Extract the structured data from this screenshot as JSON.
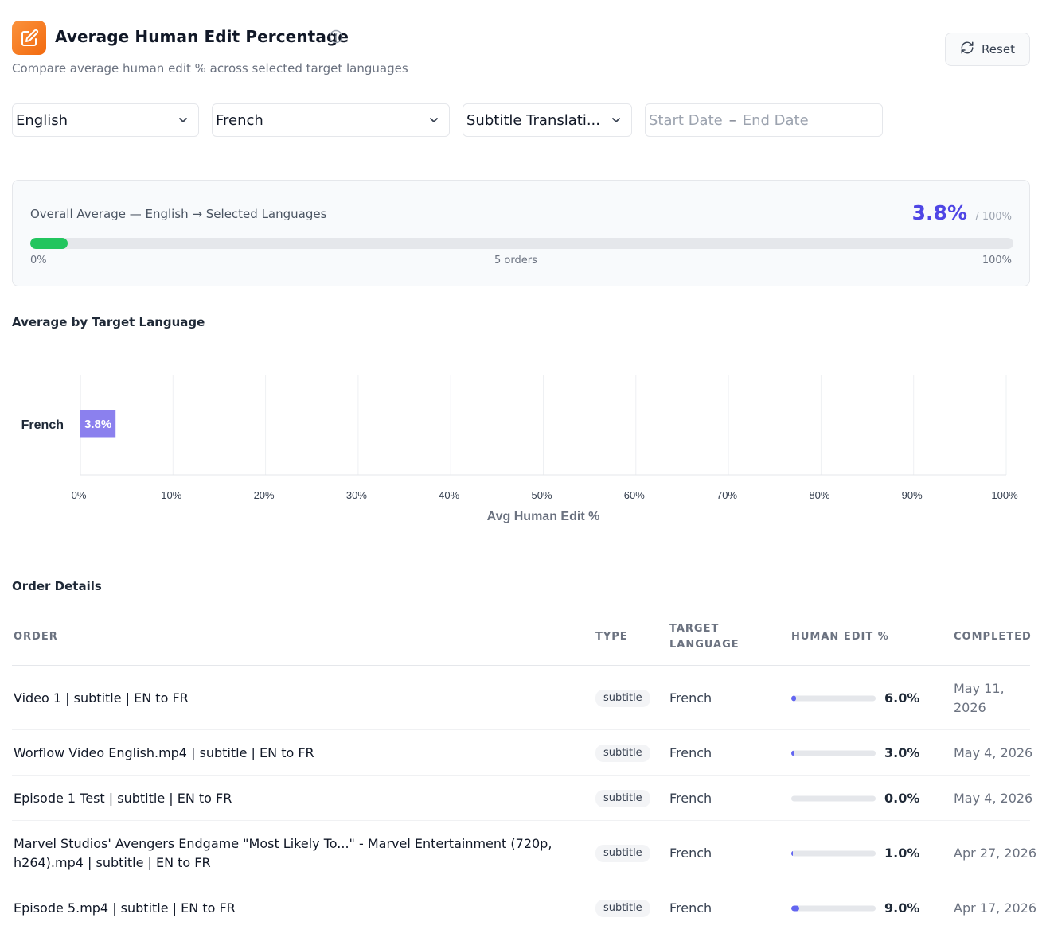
{
  "header": {
    "title": "Average Human Edit Percentage",
    "subtitle": "Compare average human edit % across selected target languages",
    "reset_label": "Reset",
    "logo_icon": "edit-icon",
    "accent": "#f97316"
  },
  "filters": {
    "source_language": "English",
    "target_language": "French",
    "type": "Subtitle Translati...",
    "date_start_placeholder": "Start Date",
    "date_separator": "–",
    "date_end_placeholder": "End Date"
  },
  "overall": {
    "label": "Overall Average — English → Selected Languages",
    "value": "3.8%",
    "value_number": 3.8,
    "max": "/ 100%",
    "scale_min": "0%",
    "orders": "5 orders",
    "scale_max": "100%",
    "fill_color": "#22c55e"
  },
  "chart_section": {
    "title": "Average by Target Language"
  },
  "chart_data": {
    "type": "bar",
    "orientation": "horizontal",
    "categories": [
      "French"
    ],
    "values": [
      3.8
    ],
    "data_labels": [
      "3.8%"
    ],
    "xlabel": "Avg Human Edit %",
    "xlim": [
      0,
      100
    ],
    "xticks": [
      "0%",
      "10%",
      "20%",
      "30%",
      "40%",
      "50%",
      "60%",
      "70%",
      "80%",
      "90%",
      "100%"
    ],
    "grid": true,
    "bar_color": "#8b80ee"
  },
  "orders": {
    "title": "Order Details",
    "columns": {
      "order": "ORDER",
      "type": "TYPE",
      "target_language_1": "TARGET",
      "target_language_2": "LANGUAGE",
      "human_edit": "HUMAN EDIT %",
      "completed": "COMPLETED"
    },
    "rows": [
      {
        "order": "Video 1 | subtitle | EN to FR",
        "type": "subtitle",
        "language": "French",
        "pct": "6.0%",
        "pct_value": 6.0,
        "completed": "May 11, 2026"
      },
      {
        "order": "Worflow Video English.mp4 | subtitle | EN to FR",
        "type": "subtitle",
        "language": "French",
        "pct": "3.0%",
        "pct_value": 3.0,
        "completed": "May 4, 2026"
      },
      {
        "order": "Episode 1 Test | subtitle | EN to FR",
        "type": "subtitle",
        "language": "French",
        "pct": "0.0%",
        "pct_value": 0.0,
        "completed": "May 4, 2026"
      },
      {
        "order": "Marvel Studios' Avengers Endgame \"Most Likely To...\" - Marvel Entertainment (720p, h264).mp4 | subtitle | EN to FR",
        "type": "subtitle",
        "language": "French",
        "pct": "1.0%",
        "pct_value": 1.0,
        "completed": "Apr 27, 2026"
      },
      {
        "order": "Episode 5.mp4 | subtitle | EN to FR",
        "type": "subtitle",
        "language": "French",
        "pct": "9.0%",
        "pct_value": 9.0,
        "completed": "Apr 17, 2026"
      }
    ]
  }
}
